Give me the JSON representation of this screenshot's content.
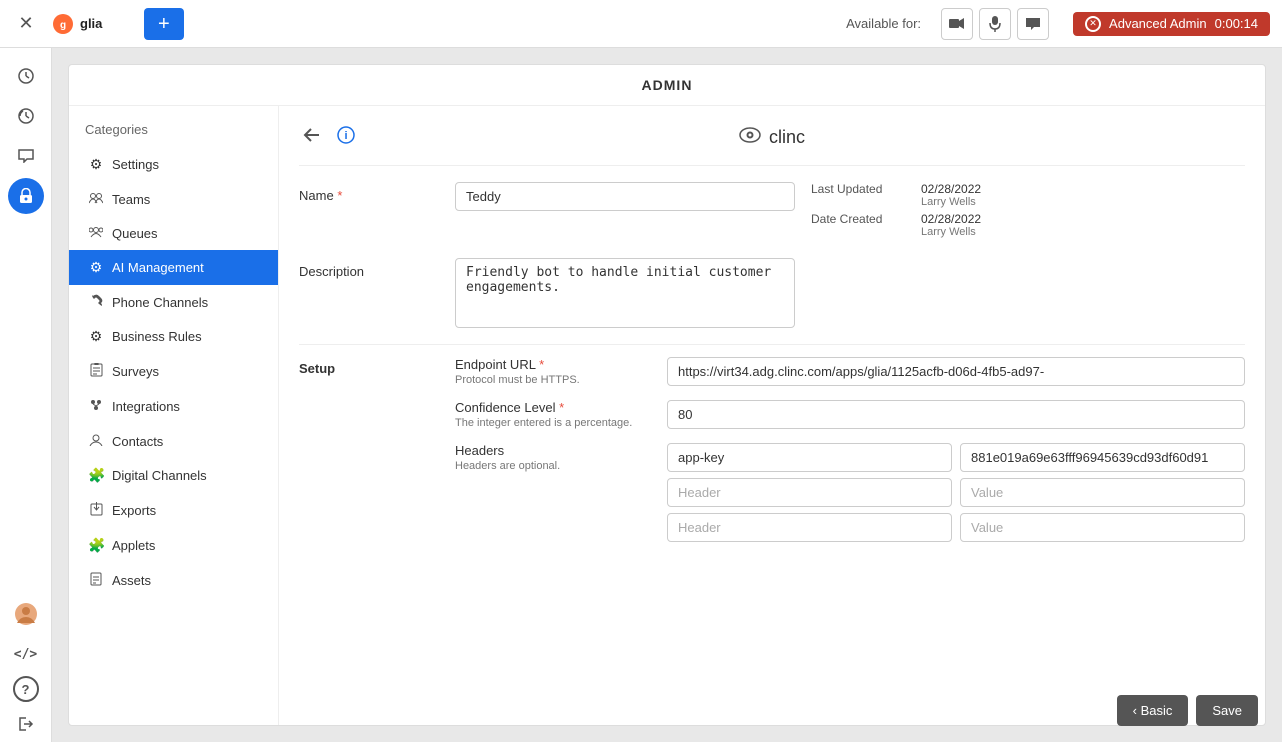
{
  "topbar": {
    "close_icon": "✕",
    "add_label": "+",
    "available_for": "Available for:",
    "video_icon": "📷",
    "mic_icon": "🎤",
    "chat_icon": "💬",
    "admin_label": "Advanced Admin",
    "timer": "0:00:14"
  },
  "left_nav": {
    "icons": [
      {
        "name": "clock-icon",
        "symbol": "🕐",
        "active": false
      },
      {
        "name": "history-icon",
        "symbol": "🕑",
        "active": false
      },
      {
        "name": "chat-nav-icon",
        "symbol": "💬",
        "active": false
      },
      {
        "name": "lock-icon",
        "symbol": "🔒",
        "active": true
      },
      {
        "name": "user-icon",
        "symbol": "👤",
        "active": false
      },
      {
        "name": "code-icon",
        "symbol": "</>",
        "active": false
      },
      {
        "name": "help-icon",
        "symbol": "?",
        "active": false
      },
      {
        "name": "logout-icon",
        "symbol": "→",
        "active": false
      }
    ]
  },
  "admin": {
    "title": "ADMIN"
  },
  "sidebar": {
    "title": "Categories",
    "items": [
      {
        "id": "settings",
        "label": "Settings",
        "icon": "⚙"
      },
      {
        "id": "teams",
        "label": "Teams",
        "icon": "⚡"
      },
      {
        "id": "queues",
        "label": "Queues",
        "icon": "👥"
      },
      {
        "id": "ai-management",
        "label": "AI Management",
        "icon": "⚙",
        "active": true
      },
      {
        "id": "phone-channels",
        "label": "Phone Channels",
        "icon": "📞"
      },
      {
        "id": "business-rules",
        "label": "Business Rules",
        "icon": "⚙"
      },
      {
        "id": "surveys",
        "label": "Surveys",
        "icon": "📋"
      },
      {
        "id": "integrations",
        "label": "Integrations",
        "icon": "🔧"
      },
      {
        "id": "contacts",
        "label": "Contacts",
        "icon": "👥"
      },
      {
        "id": "digital-channels",
        "label": "Digital Channels",
        "icon": "🧩"
      },
      {
        "id": "exports",
        "label": "Exports",
        "icon": "📤"
      },
      {
        "id": "applets",
        "label": "Applets",
        "icon": "🧩"
      },
      {
        "id": "assets",
        "label": "Assets",
        "icon": "📄"
      }
    ]
  },
  "content": {
    "brand_logo": "clinc",
    "brand_icon": "👁",
    "form": {
      "name_label": "Name",
      "name_required": true,
      "name_value": "Teddy",
      "description_label": "Description",
      "description_value": "Friendly bot to handle initial customer engagements.",
      "last_updated_label": "Last Updated",
      "last_updated_date": "02/28/2022",
      "last_updated_by": "Larry Wells",
      "date_created_label": "Date Created",
      "date_created_date": "02/28/2022",
      "date_created_by": "Larry Wells"
    },
    "setup": {
      "section_label": "Setup",
      "endpoint_label": "Endpoint URL",
      "endpoint_required": true,
      "endpoint_hint": "Protocol must be HTTPS.",
      "endpoint_value": "https://virt34.adg.clinc.com/apps/glia/1125acfb-d06d-4fb5-ad97-",
      "confidence_label": "Confidence Level",
      "confidence_required": true,
      "confidence_hint": "The integer entered is a percentage.",
      "confidence_value": "80",
      "headers_label": "Headers",
      "headers_hint": "Headers are optional.",
      "header_rows": [
        {
          "key": "app-key",
          "value": "881e019a69e63fff96945639cd93df60d91"
        },
        {
          "key": "",
          "value": ""
        },
        {
          "key": "",
          "value": ""
        }
      ],
      "header_placeholder": "Header",
      "value_placeholder": "Value"
    },
    "buttons": {
      "basic_label": "‹ Basic",
      "save_label": "Save"
    }
  }
}
